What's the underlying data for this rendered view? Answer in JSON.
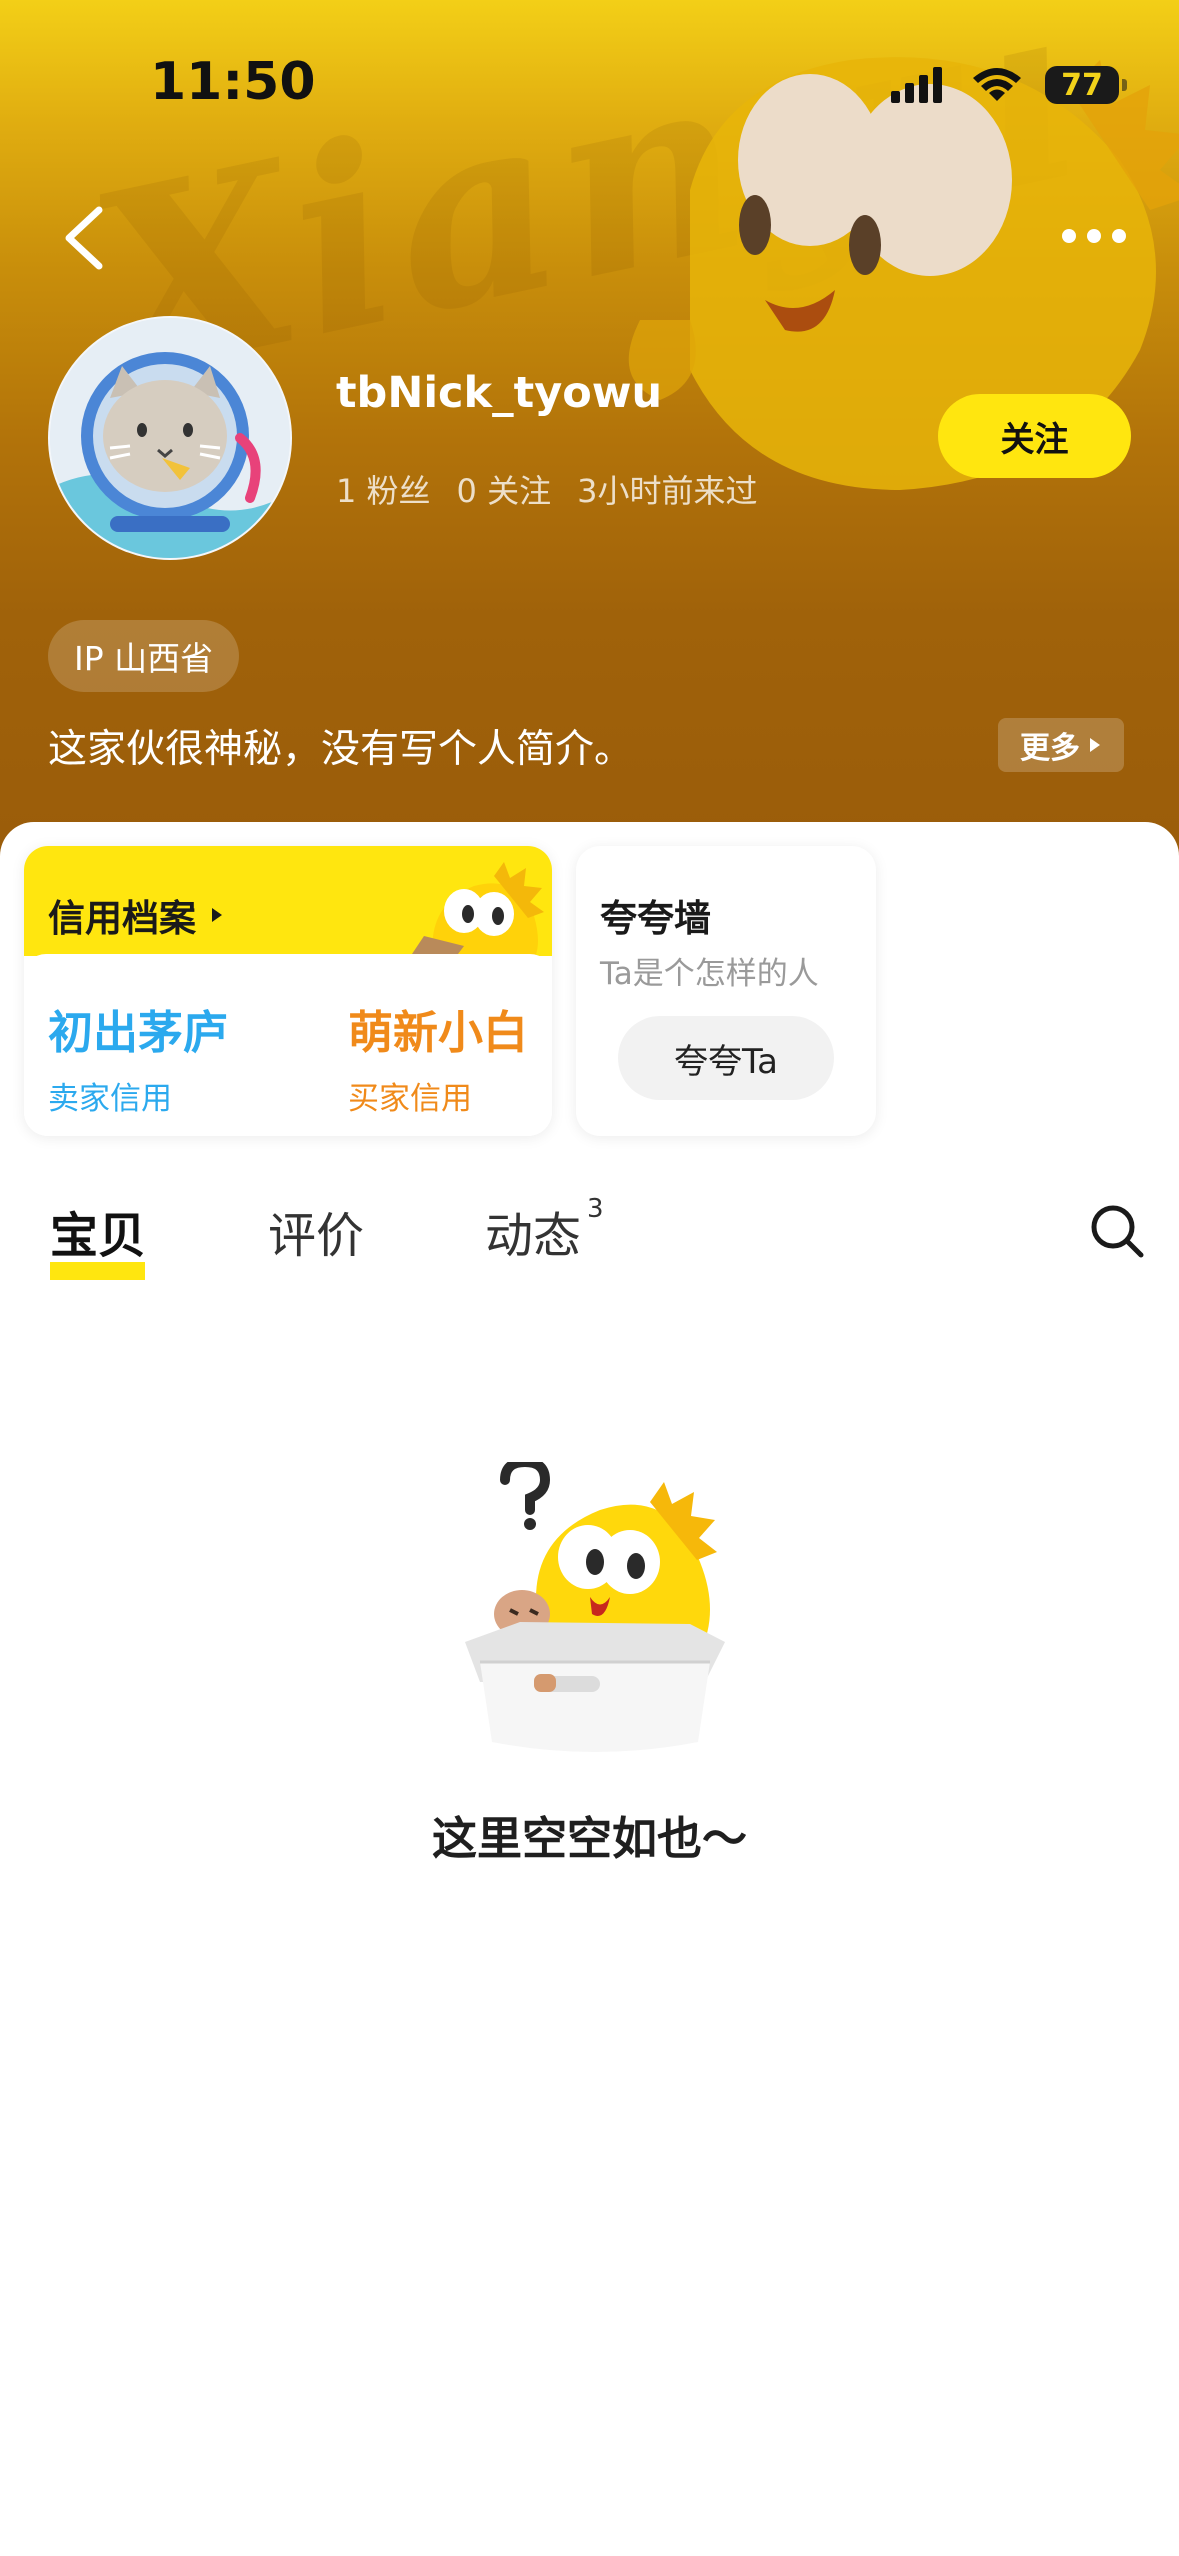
{
  "status_bar": {
    "time": "11:50",
    "battery": "77"
  },
  "header": {
    "watermark": "Xianyu",
    "username": "tbNick_tyowu",
    "stats": {
      "fans": "1 粉丝",
      "following": "0 关注",
      "last_seen": "3小时前来过"
    },
    "follow_label": "关注",
    "ip_location": "IP 山西省",
    "bio": "这家伙很神秘，没有写个人简介。",
    "more_label": "更多"
  },
  "credit": {
    "title": "信用档案",
    "seller_rank": "初出茅庐",
    "seller_label": "卖家信用",
    "buyer_rank": "萌新小白",
    "buyer_label": "买家信用"
  },
  "praise": {
    "title": "夸夸墙",
    "subtitle": "Ta是个怎样的人",
    "button": "夸夸Ta"
  },
  "tabs": [
    {
      "label": "宝贝",
      "active": true
    },
    {
      "label": "评价",
      "active": false
    },
    {
      "label": "动态",
      "badge": "3",
      "active": false
    }
  ],
  "empty_state": {
    "text": "这里空空如也～"
  },
  "colors": {
    "accent_yellow": "#ffe60f",
    "seller_blue": "#2ba9ee",
    "buyer_orange": "#f08a1a"
  },
  "icons": [
    "back-arrow-icon",
    "more-dots-icon",
    "signal-icon",
    "wifi-icon",
    "battery-icon",
    "triangle-right-icon",
    "search-icon"
  ]
}
